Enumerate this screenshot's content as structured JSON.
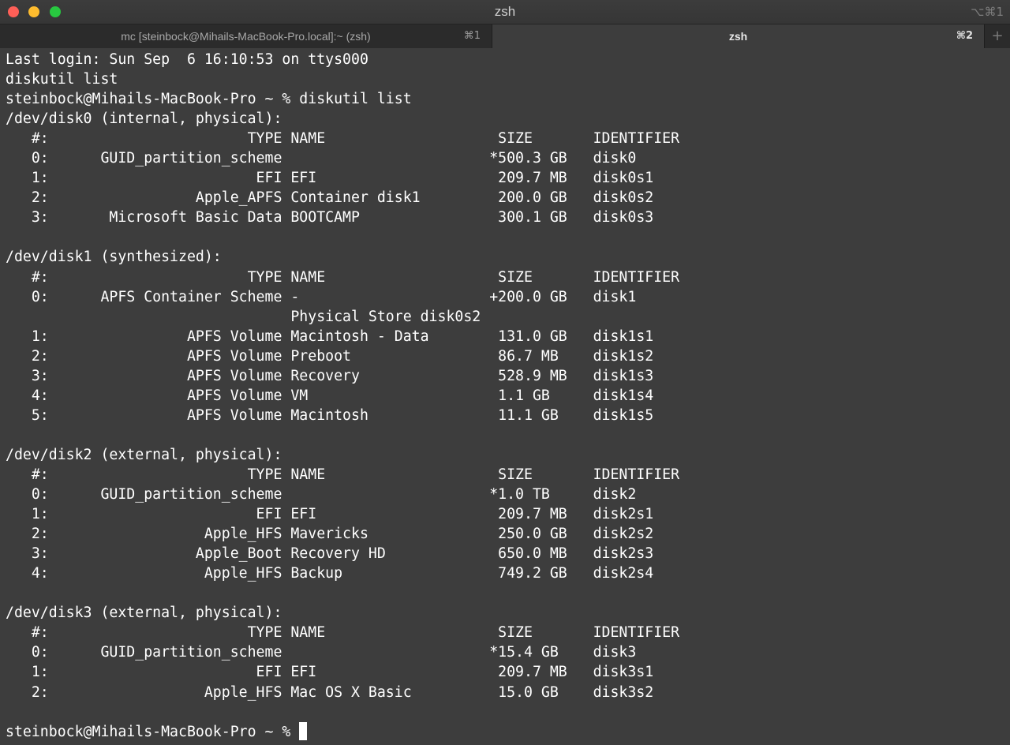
{
  "window": {
    "title": "zsh",
    "title_shortcut": "⌥⌘1",
    "colors": {
      "background": "#3d3d3d",
      "text": "#ffffff",
      "close": "#fe5f57",
      "minimize": "#febc2e",
      "maximize": "#28c840"
    }
  },
  "tabs": [
    {
      "label": "mc [steinbock@Mihails-MacBook-Pro.local]:~ (zsh)",
      "shortcut": "⌘1"
    },
    {
      "label": "zsh",
      "shortcut": "⌘2"
    }
  ],
  "new_tab_icon": "+",
  "terminal": {
    "lines": [
      "Last login: Sun Sep  6 16:10:53 on ttys000",
      "diskutil list",
      "steinbock@Mihails-MacBook-Pro ~ % diskutil list",
      "/dev/disk0 (internal, physical):",
      "   #:                       TYPE NAME                    SIZE       IDENTIFIER",
      "   0:      GUID_partition_scheme                        *500.3 GB   disk0",
      "   1:                        EFI EFI                     209.7 MB   disk0s1",
      "   2:                 Apple_APFS Container disk1         200.0 GB   disk0s2",
      "   3:       Microsoft Basic Data BOOTCAMP                300.1 GB   disk0s3",
      "",
      "/dev/disk1 (synthesized):",
      "   #:                       TYPE NAME                    SIZE       IDENTIFIER",
      "   0:      APFS Container Scheme -                      +200.0 GB   disk1",
      "                                 Physical Store disk0s2",
      "   1:                APFS Volume Macintosh - Data        131.0 GB   disk1s1",
      "   2:                APFS Volume Preboot                 86.7 MB    disk1s2",
      "   3:                APFS Volume Recovery                528.9 MB   disk1s3",
      "   4:                APFS Volume VM                      1.1 GB     disk1s4",
      "   5:                APFS Volume Macintosh               11.1 GB    disk1s5",
      "",
      "/dev/disk2 (external, physical):",
      "   #:                       TYPE NAME                    SIZE       IDENTIFIER",
      "   0:      GUID_partition_scheme                        *1.0 TB     disk2",
      "   1:                        EFI EFI                     209.7 MB   disk2s1",
      "   2:                  Apple_HFS Mavericks               250.0 GB   disk2s2",
      "   3:                 Apple_Boot Recovery HD             650.0 MB   disk2s3",
      "   4:                  Apple_HFS Backup                  749.2 GB   disk2s4",
      "",
      "/dev/disk3 (external, physical):",
      "   #:                       TYPE NAME                    SIZE       IDENTIFIER",
      "   0:      GUID_partition_scheme                        *15.4 GB    disk3",
      "   1:                        EFI EFI                     209.7 MB   disk3s1",
      "   2:                  Apple_HFS Mac OS X Basic          15.0 GB    disk3s2",
      ""
    ],
    "prompt": "steinbock@Mihails-MacBook-Pro ~ % "
  }
}
